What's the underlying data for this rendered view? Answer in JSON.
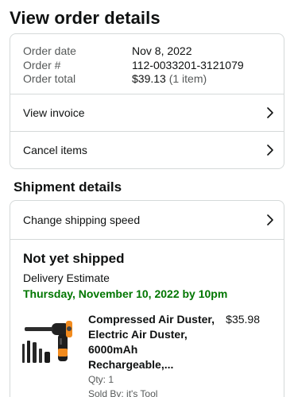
{
  "page_title": "View order details",
  "order": {
    "rows": [
      {
        "label": "Order date",
        "value": "Nov 8, 2022"
      },
      {
        "label": "Order #",
        "value": "112-0033201-3121079"
      },
      {
        "label": "Order total",
        "value": "$39.13",
        "extra": "(1 item)"
      }
    ],
    "view_invoice_label": "View invoice",
    "cancel_items_label": "Cancel items"
  },
  "shipment": {
    "section_title": "Shipment details",
    "change_speed_label": "Change shipping speed",
    "status": "Not yet shipped",
    "delivery_label": "Delivery Estimate",
    "delivery_date": "Thursday, November 10, 2022 by 10pm",
    "item": {
      "title_lines": [
        "Compressed Air Duster,",
        "Electric Air Duster,",
        "6000mAh",
        "Rechargeable,..."
      ],
      "price": "$35.98",
      "qty": "Qty: 1",
      "seller": "Sold By: it's Tool"
    }
  },
  "icons": {
    "chevron": "chevron-right-icon",
    "thumbnail": "air-duster-product-image"
  },
  "colors": {
    "text": "#0f1111",
    "muted": "#565959",
    "border": "#d5d9d9",
    "delivery_green": "#007600"
  }
}
